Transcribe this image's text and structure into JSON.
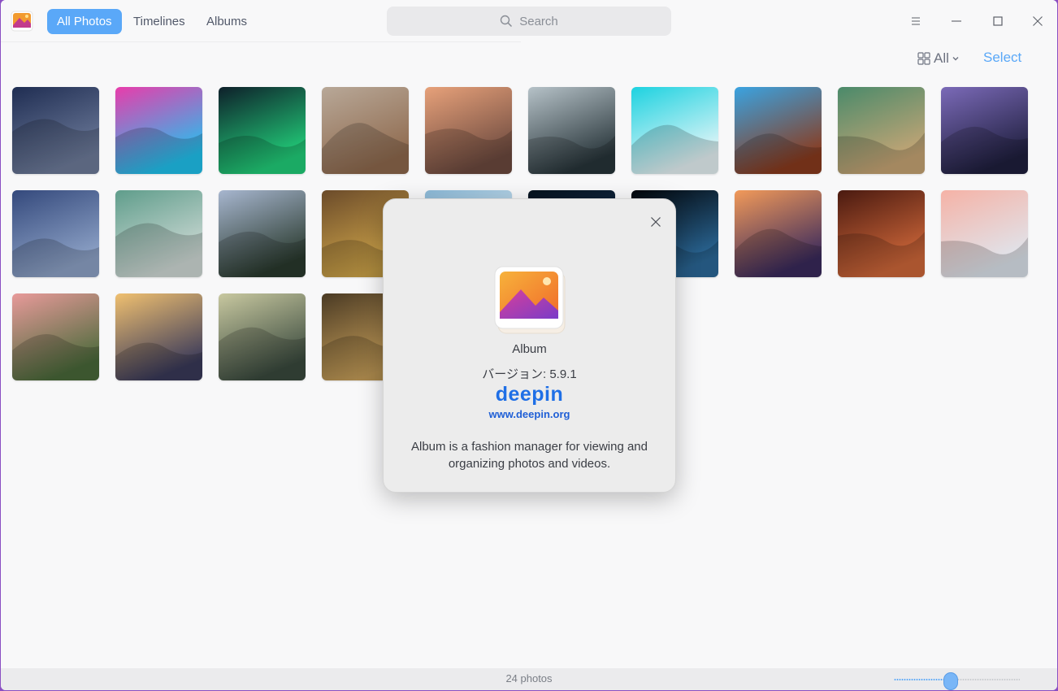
{
  "titlebar": {
    "app_icon": "album-app-icon",
    "tabs": [
      {
        "label": "All Photos",
        "active": true
      },
      {
        "label": "Timelines",
        "active": false
      },
      {
        "label": "Albums",
        "active": false
      }
    ],
    "search": {
      "placeholder": "Search",
      "icon": "search-icon"
    },
    "window_controls": [
      "menu-icon",
      "minimize-icon",
      "maximize-icon",
      "close-icon"
    ]
  },
  "toolbar": {
    "view_filter": {
      "icon": "grid-view-icon",
      "label": "All",
      "caret": "chevron-down-icon"
    },
    "select_label": "Select"
  },
  "photos": [
    {
      "subject": "night sand dunes",
      "colors": [
        "#1f2d52",
        "#6f7d9c"
      ]
    },
    {
      "subject": "deepin logo gradient",
      "colors": [
        "#e93cab",
        "#20c4f0"
      ]
    },
    {
      "subject": "aurora borealis",
      "colors": [
        "#0e1f2a",
        "#22d07a"
      ]
    },
    {
      "subject": "desert dunes",
      "colors": [
        "#b8a898",
        "#8f6a4e"
      ]
    },
    {
      "subject": "dune at sunset",
      "colors": [
        "#e7a17a",
        "#6d4a3f"
      ]
    },
    {
      "subject": "misty forest",
      "colors": [
        "#b6c2c8",
        "#28353a"
      ]
    },
    {
      "subject": "white pyramid",
      "colors": [
        "#1dd2e0",
        "#e9f6f8"
      ]
    },
    {
      "subject": "antelope canyon arch",
      "colors": [
        "#3aa3e1",
        "#8a3b1e"
      ]
    },
    {
      "subject": "aerial beach",
      "colors": [
        "#4a8a6a",
        "#c9a676"
      ]
    },
    {
      "subject": "mountain lake dusk",
      "colors": [
        "#7b6ab8",
        "#1f1f3e"
      ]
    },
    {
      "subject": "blue dune",
      "colors": [
        "#34497c",
        "#8fa4c8"
      ]
    },
    {
      "subject": "waterfall bird",
      "colors": [
        "#5f9d8b",
        "#d2dcd8"
      ]
    },
    {
      "subject": "mountain reflection",
      "colors": [
        "#a7b6cf",
        "#2a3a2e"
      ]
    },
    {
      "subject": "autumn valley",
      "colors": [
        "#6b4b2a",
        "#d0a64a"
      ]
    },
    {
      "subject": "ice cave",
      "colors": [
        "#8ab8d6",
        "#e8f2f8"
      ]
    },
    {
      "subject": "deep ocean",
      "colors": [
        "#06121e",
        "#18365a"
      ]
    },
    {
      "subject": "whale dark water",
      "colors": [
        "#020509",
        "#2c6a9a"
      ]
    },
    {
      "subject": "rocky shore sunset",
      "colors": [
        "#f29a5a",
        "#3a2a5c"
      ]
    },
    {
      "subject": "slot canyon",
      "colors": [
        "#4a1a10",
        "#d0683a"
      ]
    },
    {
      "subject": "snowy peaks",
      "colors": [
        "#f5b2a6",
        "#dfe6ee"
      ]
    },
    {
      "subject": "pink clouds hills",
      "colors": [
        "#e89a9a",
        "#4a6a3a"
      ]
    },
    {
      "subject": "icy beach sunset",
      "colors": [
        "#f0c070",
        "#3a3a5a"
      ]
    },
    {
      "subject": "foggy lake",
      "colors": [
        "#c8c8a0",
        "#3a4a3e"
      ]
    },
    {
      "subject": "autumn forest",
      "colors": [
        "#4a3a24",
        "#c8a05a"
      ]
    }
  ],
  "status": {
    "count_label": "24 photos",
    "zoom_fraction": 0.45
  },
  "about_dialog": {
    "app_name": "Album",
    "version_label": "バージョン: 5.9.1",
    "logo_text": "deepin",
    "website": "www.deepin.org",
    "description": "Album is a fashion manager for viewing and organizing photos and videos.",
    "close_icon": "close-icon"
  },
  "colors": {
    "accent": "#5aa8f8",
    "window_bg": "#f8f8f9",
    "link": "#1f5fd6"
  }
}
